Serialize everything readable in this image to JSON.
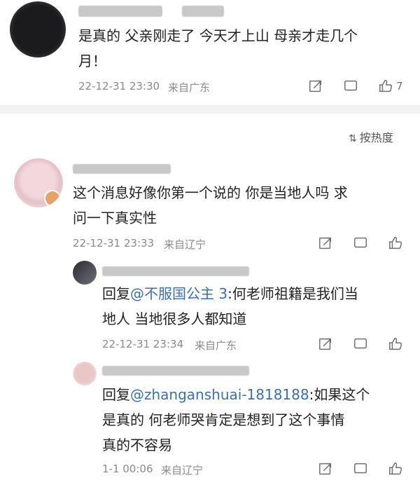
{
  "top_comment": {
    "text_line1": "是真的 父亲刚走了 今天才上山 母亲才走几个",
    "text_line2": "月！",
    "time": "22-12-31 23:30",
    "location": "来自广东",
    "like_count": "7"
  },
  "sort": {
    "label": "按热度"
  },
  "comment": {
    "text_line1": "这个消息好像你第一个说的 你是当地人吗 求",
    "text_line2": "问一下真实性",
    "time": "22-12-31 23:33",
    "location": "来自辽宁"
  },
  "replies": [
    {
      "prefix": "回复",
      "mention": "@不服国公主 3",
      "text_after_mention": ":何老师祖籍是我们当",
      "text_line2": "地人 当地很多人都知道",
      "time": "22-12-31 23:34",
      "location": "来自广东"
    },
    {
      "prefix": "回复",
      "mention": "@zhanganshuai-1818188",
      "text_after_mention": ":如果这个",
      "text_line2": "是真的 何老师哭肯定是想到了这个事情",
      "text_line3": "真的不容易",
      "time": "1-1 00:06",
      "location": "来自辽宁"
    }
  ]
}
